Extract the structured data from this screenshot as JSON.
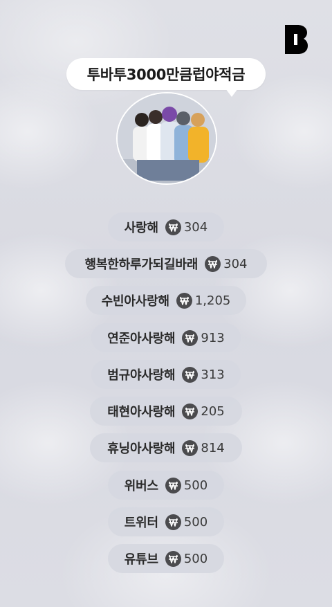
{
  "title": "투바투3000만큼럽야적금",
  "avatar_alt": "group-photo",
  "icons": {
    "logo": "b-logo-icon",
    "currency": "won-coin-icon"
  },
  "colors": {
    "background": "#dcdde4",
    "chip": "#d6d8e0",
    "logo": "#000000"
  },
  "items": [
    {
      "label": "사랑해",
      "amount": "304"
    },
    {
      "label": "행복한하루가되길바래",
      "amount": "304"
    },
    {
      "label": "수빈아사랑해",
      "amount": "1,205"
    },
    {
      "label": "연준아사랑해",
      "amount": "913"
    },
    {
      "label": "범규야사랑해",
      "amount": "313"
    },
    {
      "label": "태현아사랑해",
      "amount": "205"
    },
    {
      "label": "휴닝아사랑해",
      "amount": "814"
    },
    {
      "label": "위버스",
      "amount": "500"
    },
    {
      "label": "트위터",
      "amount": "500"
    },
    {
      "label": "유튜브",
      "amount": "500"
    }
  ]
}
